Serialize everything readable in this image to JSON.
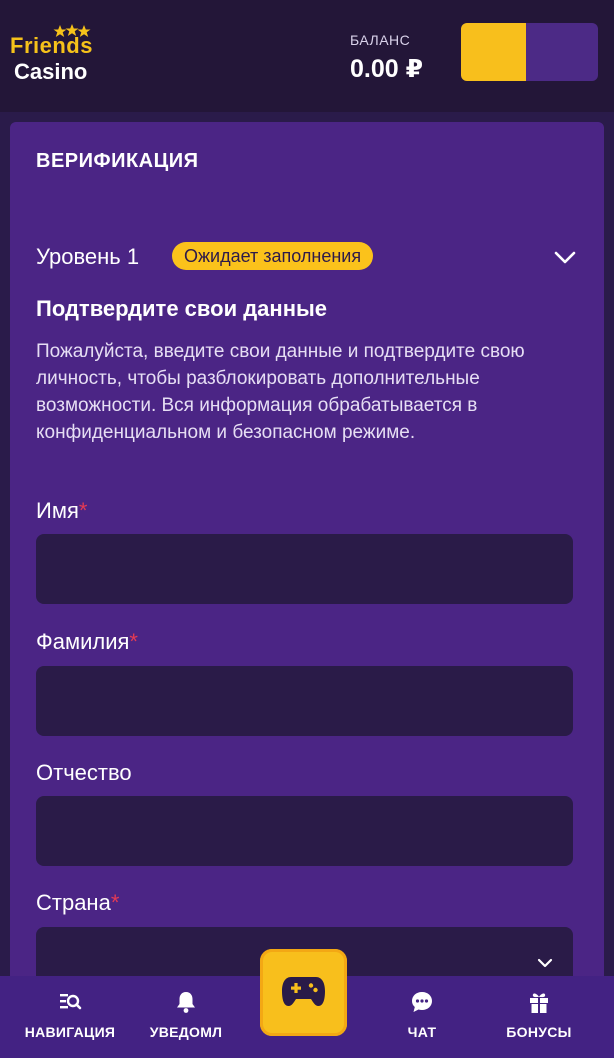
{
  "header": {
    "logo_top": "Friends",
    "logo_bottom": "Casino",
    "balance_label": "БАЛАНС",
    "balance_value": "0.00 ₽"
  },
  "card": {
    "title": "ВЕРИФИКАЦИЯ",
    "level_label": "Уровень 1",
    "level_status": "Ожидает заполнения",
    "subtitle": "Подтвердите свои данные",
    "description": "Пожалуйста, введите свои данные и подтвердите свою личность, чтобы разблокировать дополнительные возможности. Вся информация обрабатывается в конфиденциальном и безопасном режиме."
  },
  "form": {
    "first_name": {
      "label": "Имя",
      "required_mark": "*",
      "value": ""
    },
    "last_name": {
      "label": "Фамилия",
      "required_mark": "*",
      "value": ""
    },
    "patronymic": {
      "label": "Отчество",
      "value": ""
    },
    "country": {
      "label": "Страна",
      "required_mark": "*",
      "value": ""
    }
  },
  "nav": {
    "navigation": "НАВИГАЦИЯ",
    "notifications": "УВЕДОМЛ",
    "chat": "ЧАТ",
    "bonuses": "БОНУСЫ"
  },
  "colors": {
    "accent_yellow": "#f8bf1c",
    "card_purple": "#4b2585",
    "header_dark": "#231638",
    "required_red": "#e43a54"
  },
  "icons": [
    "star-icon",
    "chevron-down-icon",
    "search-list-icon",
    "bell-icon",
    "gamepad-icon",
    "chat-bubble-icon",
    "gift-icon"
  ]
}
